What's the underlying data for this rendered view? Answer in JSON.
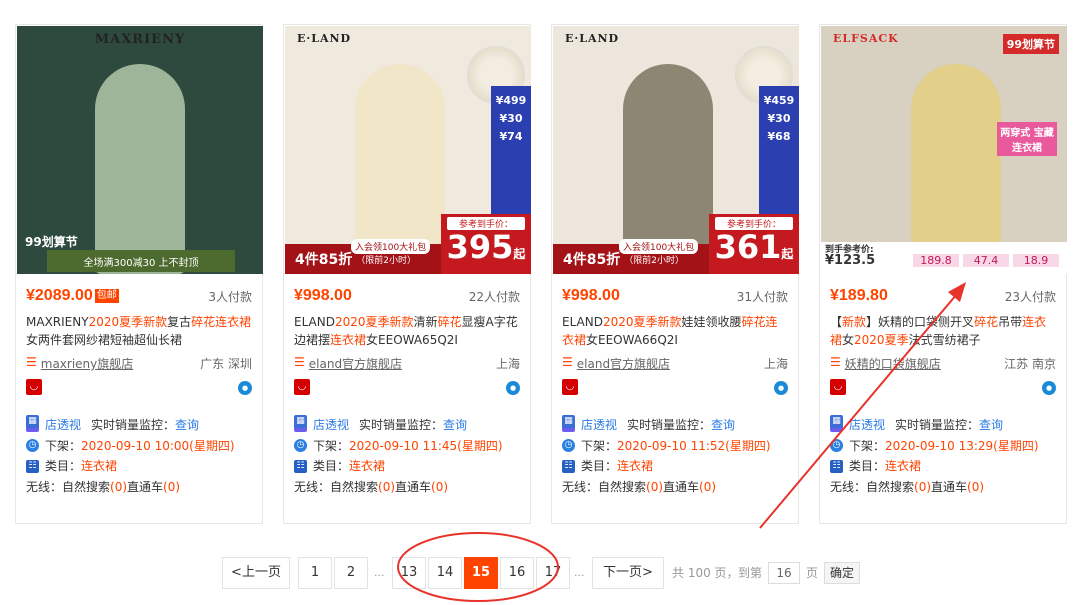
{
  "products": [
    {
      "brand_logo": "MAXRIENY",
      "image_text": "全场满300减30 上不封顶",
      "image_event": "99划算节",
      "price": "¥2089.00",
      "free_shipping": "包邮",
      "sales": "3人付款",
      "title_parts": [
        "MAXRIENY",
        "2020夏季新款",
        "复古",
        "碎花连衣裙",
        "女两件套网纱裙短袖超仙长裙"
      ],
      "shop": "maxrieny旗舰店",
      "location": "广东 深圳",
      "store_insight": "店透视",
      "realtime_label": "实时销量监控：",
      "query": "查询",
      "listed_label": "下架：",
      "listed_time": "2020-09-10 10:00(星期四)",
      "category_label": "类目：",
      "category": "连衣裙",
      "wireless_label": "无线：",
      "natural_search": "自然搜索",
      "natural_count": "(0)",
      "through_train": "直通车",
      "train_count": "(0)",
      "colors": {
        "bg": "#2e4a3e",
        "figure": "#9fb59a"
      }
    },
    {
      "brand_logo": "E·LAND",
      "image_promo": "4件85折",
      "image_promo_sub": "（限前2小时）",
      "image_vip": "入会领100大礼包",
      "image_ref_label": "参考到手价：",
      "image_ref_price": "395",
      "image_ref_unit": "起",
      "side_tags": [
        "¥499",
        "¥30",
        "¥74"
      ],
      "price": "¥998.00",
      "sales": "22人付款",
      "title_parts": [
        "ELAND",
        "2020夏季新款",
        "清新",
        "碎花",
        "显瘦A字花边裙摆",
        "连衣裙",
        "女EEOWA65Q2I"
      ],
      "shop": "eland官方旗舰店",
      "location": "上海",
      "store_insight": "店透视",
      "realtime_label": "实时销量监控：",
      "query": "查询",
      "listed_label": "下架：",
      "listed_time": "2020-09-10 11:45(星期四)",
      "category_label": "类目：",
      "category": "连衣裙",
      "wireless_label": "无线：",
      "natural_search": "自然搜索",
      "natural_count": "(0)",
      "through_train": "直通车",
      "train_count": "(0)",
      "colors": {
        "bg": "#efe9de",
        "figure": "#f1e6c8"
      }
    },
    {
      "brand_logo": "E·LAND",
      "image_promo": "4件85折",
      "image_promo_sub": "（限前2小时）",
      "image_vip": "入会领100大礼包",
      "image_ref_label": "参考到手价：",
      "image_ref_price": "361",
      "image_ref_unit": "起",
      "side_tags": [
        "¥459",
        "¥30",
        "¥68"
      ],
      "price": "¥998.00",
      "sales": "31人付款",
      "title_parts": [
        "ELAND",
        "2020夏季新款",
        "娃娃领收腰",
        "碎花连衣裙",
        "女EEOWA66Q2I"
      ],
      "shop": "eland官方旗舰店",
      "location": "上海",
      "store_insight": "店透视",
      "realtime_label": "实时销量监控：",
      "query": "查询",
      "listed_label": "下架：",
      "listed_time": "2020-09-10 11:52(星期四)",
      "category_label": "类目：",
      "category": "连衣裙",
      "wireless_label": "无线：",
      "natural_search": "自然搜索",
      "natural_count": "(0)",
      "through_train": "直通车",
      "train_count": "(0)",
      "colors": {
        "bg": "#ece6dc",
        "figure": "#8d8672"
      }
    },
    {
      "brand_logo": "ELFSACK",
      "image_event": "99划算节",
      "image_tag": "两穿式 宝藏连衣裙",
      "image_ref_label": "到手参考价:",
      "image_ref_price": "¥123.5",
      "image_prices": [
        "189.8",
        "47.4",
        "18.9"
      ],
      "price": "¥189.80",
      "sales": "23人付款",
      "title_parts": [
        "【",
        "新款",
        "】妖精的口袋",
        "侧开叉",
        "碎花",
        "吊带",
        "连衣裙",
        "女",
        "2020夏季",
        "法式雪纺裙子"
      ],
      "shop": "妖精的口袋旗舰店",
      "location": "江苏 南京",
      "store_insight": "店透视",
      "realtime_label": "实时销量监控：",
      "query": "查询",
      "listed_label": "下架：",
      "listed_time": "2020-09-10 13:29(星期四)",
      "category_label": "类目：",
      "category": "连衣裙",
      "wireless_label": "无线：",
      "natural_search": "自然搜索",
      "natural_count": "(0)",
      "through_train": "直通车",
      "train_count": "(0)",
      "colors": {
        "bg": "#d8d0c0",
        "figure": "#e2cf8a"
      }
    }
  ],
  "pagination": {
    "prev": "<上一页",
    "pages": [
      "1",
      "2",
      "13",
      "14",
      "15",
      "16",
      "17"
    ],
    "ellipsis": "...",
    "current": "15",
    "next": "下一页>",
    "total_text": "共 100 页，",
    "goto_text": "到第",
    "goto_value": "16",
    "page_unit": "页",
    "confirm": "确定"
  },
  "annotation_color": "#e8332b"
}
